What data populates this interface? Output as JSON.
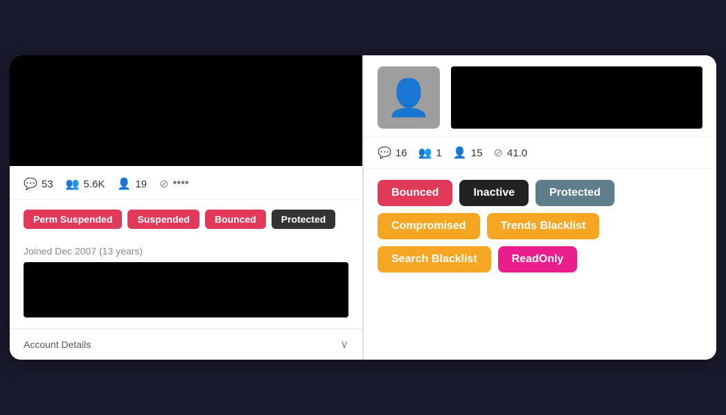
{
  "left": {
    "stats": [
      {
        "icon": "💬",
        "value": "53",
        "name": "comments-stat"
      },
      {
        "icon": "👥",
        "value": "5.6K",
        "name": "followers-stat"
      },
      {
        "icon": "👤",
        "value": "19",
        "name": "following-stat"
      },
      {
        "icon": "⊘",
        "value": "****",
        "name": "misc-stat"
      }
    ],
    "tags": [
      {
        "label": "Perm Suspended",
        "color": "red",
        "name": "perm-suspended-tag"
      },
      {
        "label": "Suspended",
        "color": "red",
        "name": "suspended-tag"
      },
      {
        "label": "Bounced",
        "color": "red",
        "name": "bounced-tag"
      },
      {
        "label": "Protected",
        "color": "dark",
        "name": "protected-tag"
      }
    ],
    "joined": "Joined Dec 2007 (13 years)",
    "account_details_label": "Account Details",
    "chevron": "∨"
  },
  "right": {
    "stats": [
      {
        "icon": "💬",
        "value": "16",
        "name": "r-comments-stat"
      },
      {
        "icon": "👥",
        "value": "1",
        "name": "r-followers-stat"
      },
      {
        "icon": "👤",
        "value": "15",
        "name": "r-following-stat"
      },
      {
        "icon": "⊘",
        "value": "41.0",
        "name": "r-misc-stat"
      }
    ],
    "tags_row1": [
      {
        "label": "Bounced",
        "color": "red",
        "name": "r-bounced-tag"
      },
      {
        "label": "Inactive",
        "color": "dark-black",
        "name": "r-inactive-tag"
      },
      {
        "label": "Protected",
        "color": "gray",
        "name": "r-protected-tag"
      }
    ],
    "tags_row2": [
      {
        "label": "Compromised",
        "color": "orange",
        "name": "r-compromised-tag"
      },
      {
        "label": "Trends Blacklist",
        "color": "orange",
        "name": "r-trends-blacklist-tag"
      }
    ],
    "tags_row3": [
      {
        "label": "Search Blacklist",
        "color": "orange",
        "name": "r-search-blacklist-tag"
      },
      {
        "label": "ReadOnly",
        "color": "pink",
        "name": "r-readonly-tag"
      }
    ]
  }
}
